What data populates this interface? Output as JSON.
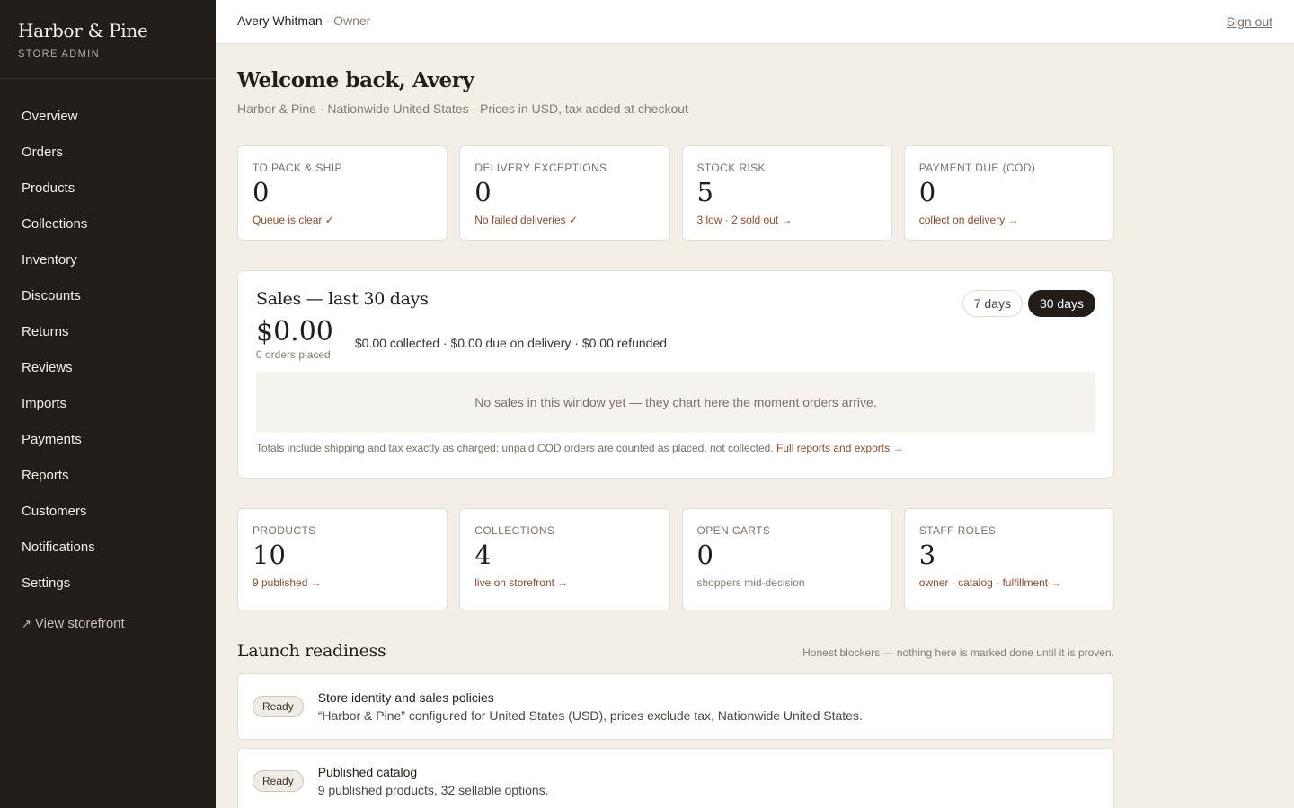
{
  "brand": {
    "name": "Harbor & Pine",
    "sub": "STORE ADMIN"
  },
  "nav": [
    "Overview",
    "Orders",
    "Products",
    "Collections",
    "Inventory",
    "Discounts",
    "Returns",
    "Reviews",
    "Imports",
    "Payments",
    "Reports",
    "Customers",
    "Notifications",
    "Settings"
  ],
  "storefront": {
    "arrow": "↗",
    "label": "View storefront"
  },
  "topbar": {
    "user": "Avery Whitman",
    "role": " · Owner",
    "signout": "Sign out"
  },
  "welcome": "Welcome back, Avery",
  "subtitle": "Harbor & Pine · Nationwide United States · Prices in USD, tax added at checkout",
  "stats": [
    {
      "label": "TO PACK & SHIP",
      "value": "0",
      "note": "Queue is clear ✓"
    },
    {
      "label": "DELIVERY EXCEPTIONS",
      "value": "0",
      "note": "No failed deliveries ✓"
    },
    {
      "label": "STOCK RISK",
      "value": "5",
      "note": "3 low · 2 sold out →"
    },
    {
      "label": "PAYMENT DUE (COD)",
      "value": "0",
      "note": "collect on delivery →"
    }
  ],
  "sales": {
    "title": "Sales — last 30 days",
    "toggle": [
      "7 days",
      "30 days"
    ],
    "total": "$0.00",
    "orders": "0 orders placed",
    "breakdown": "$0.00 collected · $0.00 due on delivery · $0.00 refunded",
    "empty": "No sales in this window yet — they chart here the moment orders arrive.",
    "footnote": "Totals include shipping and tax exactly as charged; unpaid COD orders are counted as placed, not collected.",
    "report_link": "Full reports and exports →"
  },
  "stats2": [
    {
      "label": "PRODUCTS",
      "value": "10",
      "note": "9 published →"
    },
    {
      "label": "COLLECTIONS",
      "value": "4",
      "note": "live on storefront →"
    },
    {
      "label": "OPEN CARTS",
      "value": "0",
      "note": "shoppers mid-decision"
    },
    {
      "label": "STAFF ROLES",
      "value": "3",
      "note": "owner · catalog · fulfillment →"
    }
  ],
  "launch": {
    "title": "Launch readiness",
    "note": "Honest blockers — nothing here is marked done until it is proven.",
    "items": [
      {
        "badge": "Ready",
        "title": "Store identity and sales policies",
        "desc": "“Harbor & Pine” configured for United States (USD), prices exclude tax, Nationwide United States."
      },
      {
        "badge": "Ready",
        "title": "Published catalog",
        "desc": "9 published products, 32 sellable options."
      }
    ]
  }
}
